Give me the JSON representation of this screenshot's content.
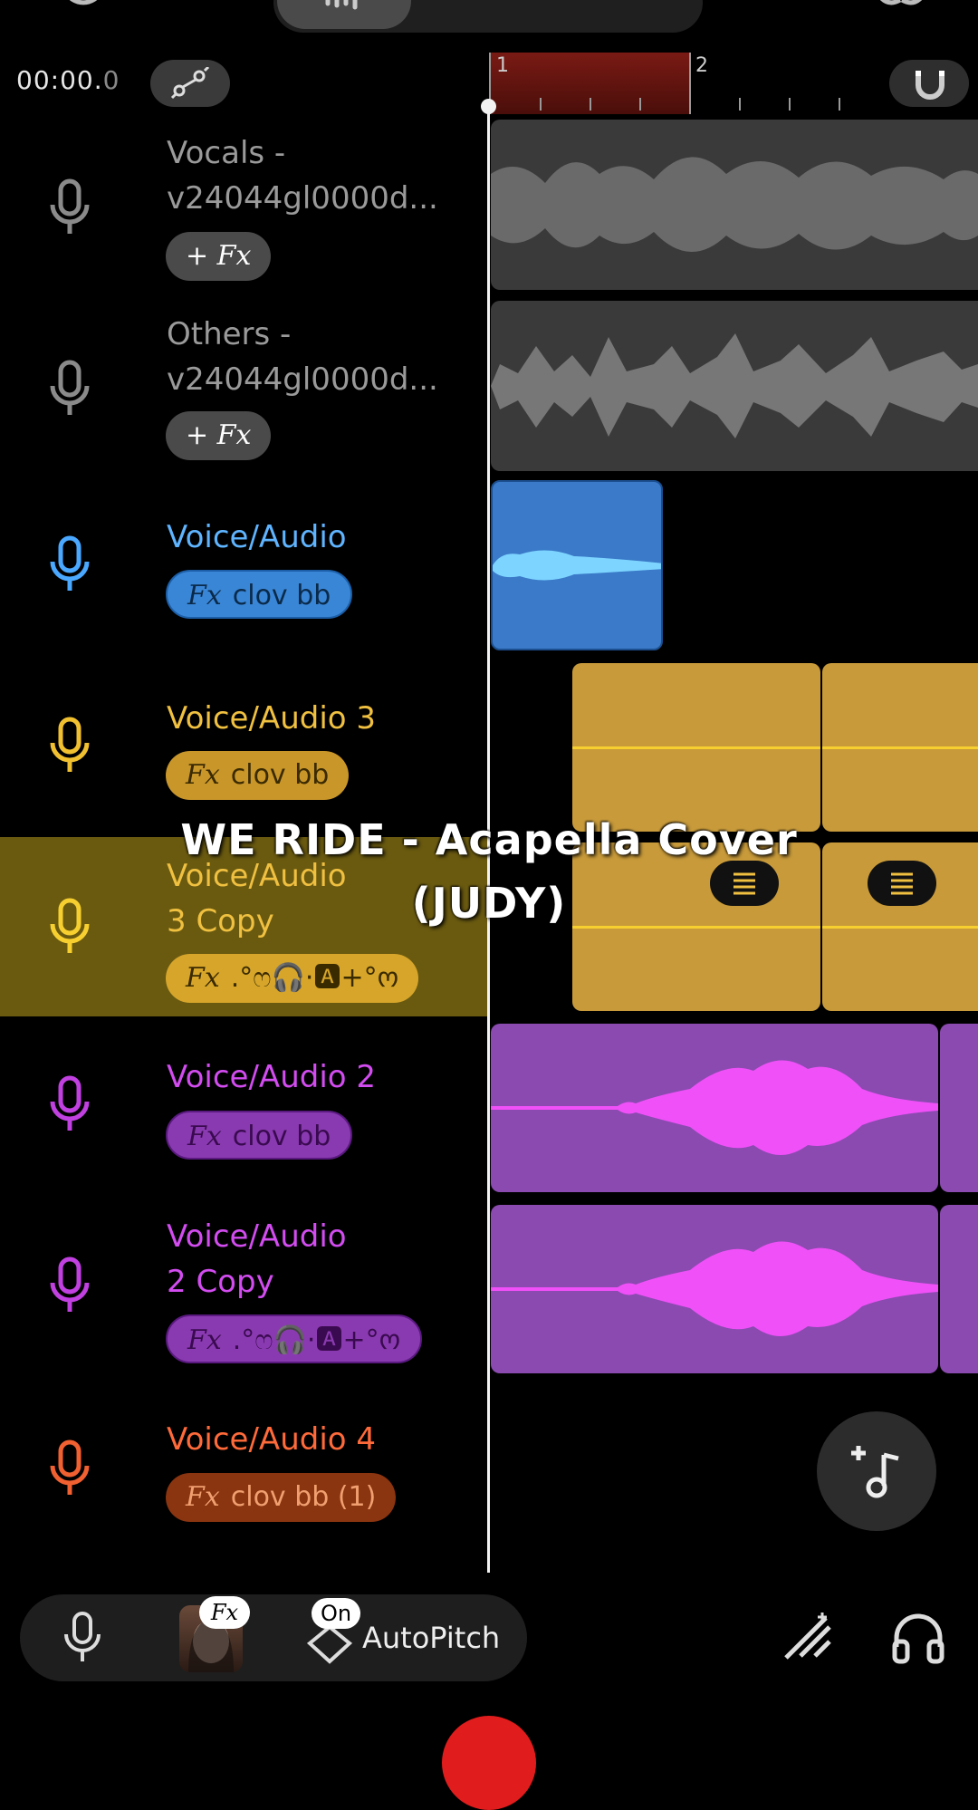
{
  "timeline": {
    "timecode_main": "00:00.",
    "timecode_tenths": "0",
    "bar_numbers": [
      "1",
      "2"
    ]
  },
  "overlay": {
    "title_line1": "WE RIDE - Acapella Cover",
    "title_line2": "(JUDY)"
  },
  "tracks": [
    {
      "name_line1": "Vocals -",
      "name_line2": "v24044gl0000d...",
      "fx": "+ Fx",
      "color": "#9a9a9a"
    },
    {
      "name_line1": "Others -",
      "name_line2": "v24044gl0000d...",
      "fx": "+ Fx",
      "color": "#9a9a9a"
    },
    {
      "name_line1": "Voice/Audio",
      "name_line2": "",
      "fx_prefix": "Fx",
      "fx": "clov bb",
      "color": "#5fb4ff"
    },
    {
      "name_line1": "Voice/Audio 3",
      "name_line2": "",
      "fx_prefix": "Fx",
      "fx": "clov bb",
      "color": "#f0c040"
    },
    {
      "name_line1": "Voice/Audio",
      "name_line2": "3 Copy",
      "fx_prefix": "Fx",
      "fx": ".°ෆ🎧·🅰+°ო",
      "color": "#f0c040"
    },
    {
      "name_line1": "Voice/Audio 2",
      "name_line2": "",
      "fx_prefix": "Fx",
      "fx": "clov bb",
      "color": "#d24cf0"
    },
    {
      "name_line1": "Voice/Audio",
      "name_line2": "2 Copy",
      "fx_prefix": "Fx",
      "fx": ".°ෆ🎧·🅰+°ო",
      "color": "#d24cf0"
    },
    {
      "name_line1": "Voice/Audio 4",
      "name_line2": "",
      "fx_prefix": "Fx",
      "fx": "clov bb (1)",
      "color": "#ff6a3a"
    }
  ],
  "toolbar": {
    "fx_badge": "Fx",
    "on_badge": "On",
    "autopitch_label": "AutoPitch"
  },
  "icons": [
    "undo-icon",
    "waveform-icon",
    "search-icon",
    "layers-icon",
    "split-icon",
    "automation-icon",
    "magnet-icon",
    "mic-icon",
    "add-track-icon",
    "diamond-icon",
    "wand-icon",
    "headphones-icon"
  ]
}
